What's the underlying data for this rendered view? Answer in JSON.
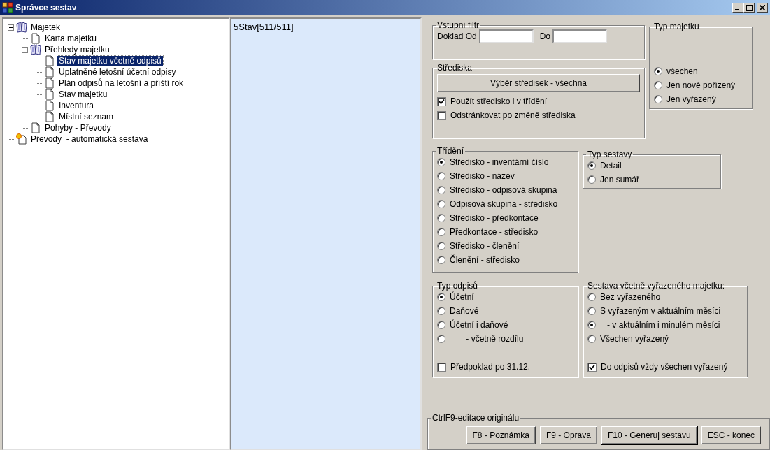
{
  "window": {
    "title": "Správce sestav"
  },
  "tree": [
    {
      "label": "Majetek",
      "kind": "book",
      "expanded": true,
      "selected": false,
      "children": [
        {
          "label": "Karta majetku",
          "kind": "page",
          "selected": false
        },
        {
          "label": "Přehledy majetku",
          "kind": "book",
          "expanded": true,
          "selected": false,
          "children": [
            {
              "label": "Stav majetku včetně odpisů",
              "kind": "page",
              "selected": true
            },
            {
              "label": "Uplatněné letošní účetní odpisy",
              "kind": "page",
              "selected": false
            },
            {
              "label": "Plán odpisů na letošní a příští rok",
              "kind": "page",
              "selected": false
            },
            {
              "label": "Stav majetku",
              "kind": "page",
              "selected": false
            },
            {
              "label": "Inventura",
              "kind": "page",
              "selected": false
            },
            {
              "label": "Místní seznam",
              "kind": "page",
              "selected": false
            }
          ]
        },
        {
          "label": "Pohyby - Převody",
          "kind": "page",
          "selected": false
        }
      ]
    },
    {
      "label": "Převody  - automatická sestava",
      "kind": "auto",
      "selected": false
    }
  ],
  "list_header": "5Stav[511/511]",
  "filter": {
    "title": "Vstupní filtr",
    "from_label": "Doklad Od",
    "to_label": "Do"
  },
  "asset_type": {
    "title": "Typ majetku",
    "options": [
      {
        "label": "všechen",
        "selected": true
      },
      {
        "label": "Jen nově pořízený",
        "selected": false
      },
      {
        "label": "Jen vyřazený",
        "selected": false
      }
    ]
  },
  "centers": {
    "title": "Střediska",
    "button": "Výběr středisek - všechna",
    "checks": [
      {
        "label": "Použít středisko i v třídění",
        "checked": true
      },
      {
        "label": "Odstránkovat po změně střediska",
        "checked": false
      }
    ]
  },
  "sorting": {
    "title": "Třídění",
    "options": [
      {
        "label": "Středisko - inventární číslo",
        "selected": true
      },
      {
        "label": "Středisko - název",
        "selected": false
      },
      {
        "label": "Středisko - odpisová skupina",
        "selected": false
      },
      {
        "label": "Odpisová skupina - středisko",
        "selected": false
      },
      {
        "label": "Středisko - předkontace",
        "selected": false
      },
      {
        "label": "Předkontace - středisko",
        "selected": false
      },
      {
        "label": "Středisko - členění",
        "selected": false
      },
      {
        "label": "Členění - středisko",
        "selected": false
      }
    ]
  },
  "report_type": {
    "title": "Typ sestavy",
    "options": [
      {
        "label": "Detail",
        "selected": true
      },
      {
        "label": "Jen sumář",
        "selected": false
      }
    ]
  },
  "depreciation_type": {
    "title": "Typ odpisů",
    "options": [
      {
        "label": "Účetní",
        "selected": true
      },
      {
        "label": "Daňové",
        "selected": false
      },
      {
        "label": "Účetní i daňové",
        "selected": false
      },
      {
        "label": "       - včetně rozdílu",
        "selected": false
      }
    ],
    "check": {
      "label": "Předpoklad po 31.12.",
      "checked": false
    }
  },
  "retired": {
    "title": "Sestava včetně vyřazeného majetku:",
    "options": [
      {
        "label": "Bez vyřazeného",
        "selected": false
      },
      {
        "label": "S vyřazeným v aktuálním měsíci",
        "selected": false
      },
      {
        "label": "   - v aktuálním i minulém měsíci",
        "selected": true
      },
      {
        "label": "Všechen vyřazený",
        "selected": false
      }
    ],
    "check": {
      "label": "Do odpisů vždy všechen vyřazený",
      "checked": true
    }
  },
  "footer": {
    "title": "CtrlF9-editace originálu",
    "buttons": [
      {
        "label": "F8 - Poznámka",
        "default": false
      },
      {
        "label": "F9 - Oprava",
        "default": false
      },
      {
        "label": "F10 - Generuj sestavu",
        "default": true
      },
      {
        "label": "ESC - konec",
        "default": false
      }
    ]
  }
}
